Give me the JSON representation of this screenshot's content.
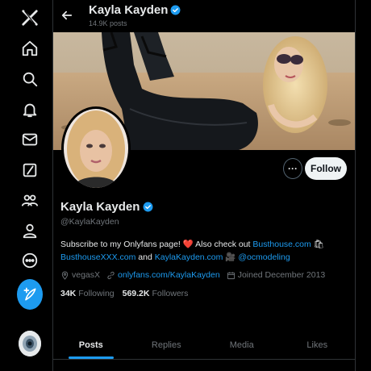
{
  "colors": {
    "accent": "#1d9bf0",
    "background": "#000000",
    "text": "#e7e9ea",
    "muted": "#71767b"
  },
  "nav": {
    "items": [
      {
        "icon": "x-logo-icon"
      },
      {
        "icon": "home-icon"
      },
      {
        "icon": "search-icon"
      },
      {
        "icon": "bell-icon"
      },
      {
        "icon": "mail-icon"
      },
      {
        "icon": "grok-icon"
      },
      {
        "icon": "communities-icon"
      },
      {
        "icon": "profile-icon"
      },
      {
        "icon": "more-circle-icon"
      }
    ],
    "compose_icon": "feather-plus-icon"
  },
  "header": {
    "name": "Kayla Kayden",
    "posts_count": "14.9K posts"
  },
  "profile": {
    "name": "Kayla Kayden",
    "handle": "@KaylaKayden",
    "follow_label": "Follow",
    "more_label": "···",
    "bio": {
      "part1": "Subscribe to my Onlyfans page! ",
      "heart": "❤️",
      "part2": " Also check out ",
      "link1": "Busthouse.com",
      "emoji1": "🛍",
      "link2": "BusthouseXXX.com",
      "part3": " and ",
      "link3": "KaylaKayden.com",
      "emoji2": "🎥",
      "link4": "@ocmodeling"
    },
    "location": "vegasX",
    "website": "onlyfans.com/KaylaKayden",
    "joined": "Joined December 2013",
    "following_count": "34K",
    "following_label": "Following",
    "followers_count": "569.2K",
    "followers_label": "Followers"
  },
  "tabs": [
    {
      "label": "Posts",
      "active": true
    },
    {
      "label": "Replies",
      "active": false
    },
    {
      "label": "Media",
      "active": false
    },
    {
      "label": "Likes",
      "active": false
    }
  ]
}
